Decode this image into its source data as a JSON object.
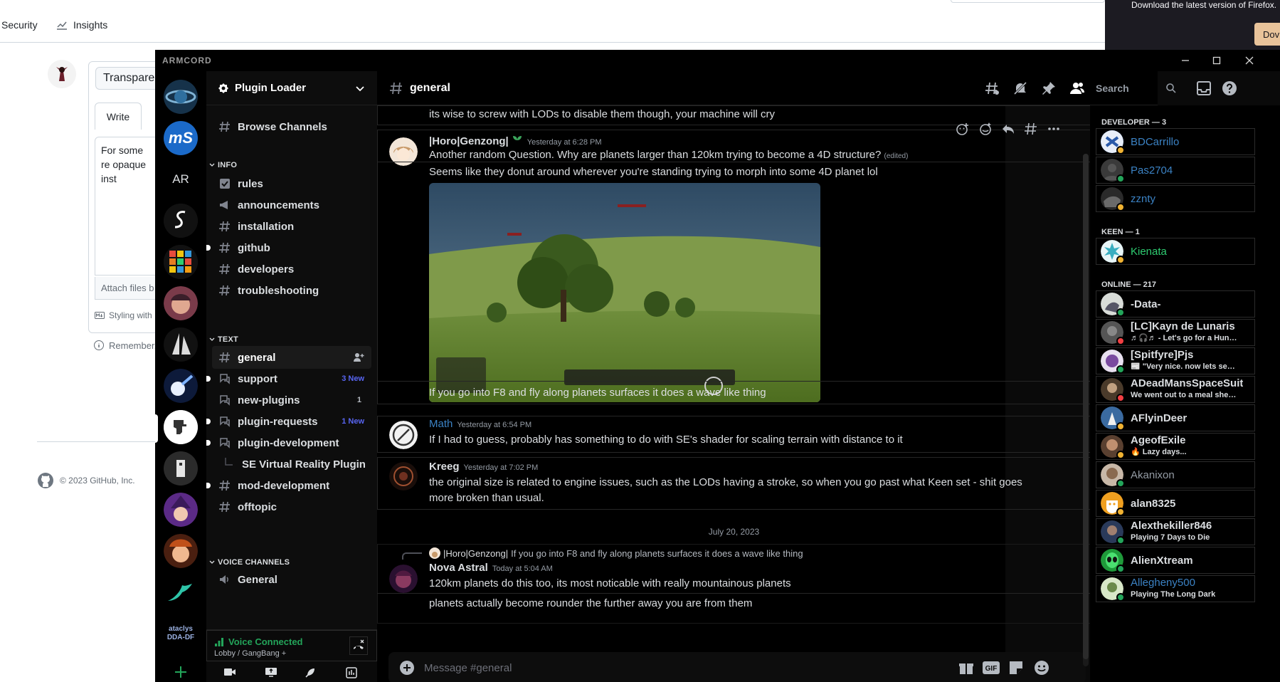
{
  "github": {
    "nav": [
      {
        "label": "Security",
        "icon": "shield-icon"
      },
      {
        "label": "Insights",
        "icon": "graph-icon"
      }
    ],
    "title_input_value": "Transpare",
    "write_tab": "Write",
    "textarea_value": "For some re opaque inst",
    "attach_text": "Attach files b",
    "styling_text": "Styling with",
    "remember_text": "Remember,",
    "footer": "© 2023 GitHub, Inc."
  },
  "firefox": {
    "notice": "Download the latest version of Firefox.",
    "button": "Dov"
  },
  "armcord": {
    "brand": "ARMCORD",
    "colors": {
      "accent": "#5865f2",
      "online": "#23a55a",
      "idle": "#f0b232",
      "dnd": "#f23f43",
      "voice": "#23a55a"
    },
    "servers": [
      {
        "name": "server-planet",
        "label": ""
      },
      {
        "name": "server-ms",
        "label": "mS"
      },
      {
        "name": "server-ar",
        "label": "AR"
      },
      {
        "name": "server-s",
        "label": ""
      },
      {
        "name": "server-grid",
        "label": ""
      },
      {
        "name": "server-face",
        "label": ""
      },
      {
        "name": "server-sail",
        "label": ""
      },
      {
        "name": "server-comet",
        "label": ""
      },
      {
        "name": "server-dino",
        "label": ""
      },
      {
        "name": "server-robot",
        "label": ""
      },
      {
        "name": "server-witch",
        "label": ""
      },
      {
        "name": "server-fox",
        "label": ""
      },
      {
        "name": "server-bird",
        "label": ""
      },
      {
        "name": "server-cataclysm",
        "label": "ataclys DDA-DF"
      }
    ],
    "guild": {
      "name": "Plugin Loader"
    },
    "browse": "Browse Channels",
    "categories": {
      "info": "INFO",
      "text": "TEXT",
      "voice": "VOICE CHANNELS"
    },
    "info_channels": [
      {
        "name": "rules",
        "icon": "rules-icon"
      },
      {
        "name": "announcements",
        "icon": "megaphone-icon"
      },
      {
        "name": "installation",
        "icon": "hash-icon"
      },
      {
        "name": "github",
        "icon": "hash-icon"
      },
      {
        "name": "developers",
        "icon": "hash-icon"
      },
      {
        "name": "troubleshooting",
        "icon": "hash-icon"
      }
    ],
    "text_channels": [
      {
        "name": "general",
        "icon": "hash-icon",
        "badge": ""
      },
      {
        "name": "support",
        "icon": "forum-icon",
        "badge": "3 New"
      },
      {
        "name": "new-plugins",
        "icon": "forum-icon",
        "badge": "1"
      },
      {
        "name": "plugin-requests",
        "icon": "forum-icon",
        "badge": "1 New"
      },
      {
        "name": "plugin-development",
        "icon": "forum-icon",
        "badge": ""
      },
      {
        "name": "SE Virtual Reality Plugin",
        "icon": "thread-icon",
        "badge": ""
      },
      {
        "name": "mod-development",
        "icon": "hash-icon",
        "badge": ""
      },
      {
        "name": "offtopic",
        "icon": "hash-icon",
        "badge": ""
      }
    ],
    "voice_channels": [
      {
        "name": "General"
      }
    ],
    "voice": {
      "status": "Voice Connected",
      "location": "Lobby / GangBang +"
    },
    "chat": {
      "channel": "general",
      "search_placeholder": "Search",
      "composer_placeholder": "Message #general",
      "messages": {
        "m0": {
          "text": "its wise to screw with LODs to disable them though, your machine will cry"
        },
        "m1": {
          "author": "|Horo|Genzong|",
          "ts": "Yesterday at 6:28 PM",
          "text": "Another random Question. Why are planets larger than 120km trying to become a 4D structure?",
          "edited": "(edited)",
          "text2": "Seems like they donut around wherever you're standing trying to morph into some 4D planet lol",
          "text3": "If you go into F8 and fly along planets surfaces it does a wave like thing"
        },
        "m2": {
          "author": "Math",
          "ts": "Yesterday at 6:54 PM",
          "text": "If I had to guess, probably has something to do with SE's shader for scaling terrain with distance to it"
        },
        "m3": {
          "author": "Kreeg",
          "ts": "Yesterday at 7:02 PM",
          "text": "the original size is related to engine issues, such as the LODs having a stroke, so when you go past what Keen set - shit goes",
          "text2": "more broken than usual."
        },
        "divider": "July 20, 2023",
        "m4": {
          "reply_author": "|Horo|Genzong|",
          "reply_text": "If you go into F8 and fly along planets surfaces it does a wave like thing",
          "author": "Nova Astral",
          "ts": "Today at 5:04 AM",
          "text": "120km planets do this too, its most noticable with really mountainous planets",
          "text2": "planets actually become rounder the further away you are from them"
        }
      }
    },
    "members": {
      "developer_header": "DEVELOPER — 3",
      "keen_header": "KEEN — 1",
      "online_header": "ONLINE — 217",
      "developers": [
        {
          "name": "BDCarrillo",
          "color": "#3b82c4",
          "status": "idle",
          "sub": ""
        },
        {
          "name": "Pas2704",
          "color": "#3b82c4",
          "status": "online",
          "sub": ""
        },
        {
          "name": "zznty",
          "color": "#3b82c4",
          "status": "idle",
          "sub": ""
        }
      ],
      "keen": [
        {
          "name": "Kienata",
          "color": "#2ecc71",
          "status": "idle",
          "sub": ""
        }
      ],
      "online": [
        {
          "name": "-Data-",
          "color": "#dbdee1",
          "status": "online",
          "sub": ""
        },
        {
          "name": "[LC]Kayn de Lunaris",
          "color": "#dbdee1",
          "status": "dnd",
          "sub": "♬🎧♬ - Let's go for a Hunt~ ..."
        },
        {
          "name": "[Spitfyre]Pjs",
          "color": "#dbdee1",
          "status": "online",
          "sub": "📰 \"Very nice. now lets see P..."
        },
        {
          "name": "ADeadMansSpaceSuit",
          "color": "#dbdee1",
          "status": "dnd",
          "sub": "We went out to a meal she or..."
        },
        {
          "name": "AFlyinDeer",
          "color": "#dbdee1",
          "status": "idle",
          "sub": ""
        },
        {
          "name": "AgeofExile",
          "color": "#dbdee1",
          "status": "idle",
          "sub": "🔥 Lazy days..."
        },
        {
          "name": "Akanixon",
          "color": "#949ba4",
          "status": "online",
          "sub": ""
        },
        {
          "name": "alan8325",
          "color": "#dbdee1",
          "status": "idle",
          "sub": ""
        },
        {
          "name": "Alexthekiller846",
          "color": "#dbdee1",
          "status": "online",
          "sub": "Playing 7 Days to Die"
        },
        {
          "name": "AlienXtream",
          "color": "#dbdee1",
          "status": "online",
          "sub": ""
        },
        {
          "name": "Allegheny500",
          "color": "#3b82c4",
          "status": "online",
          "sub": "Playing The Long Dark"
        }
      ]
    }
  }
}
